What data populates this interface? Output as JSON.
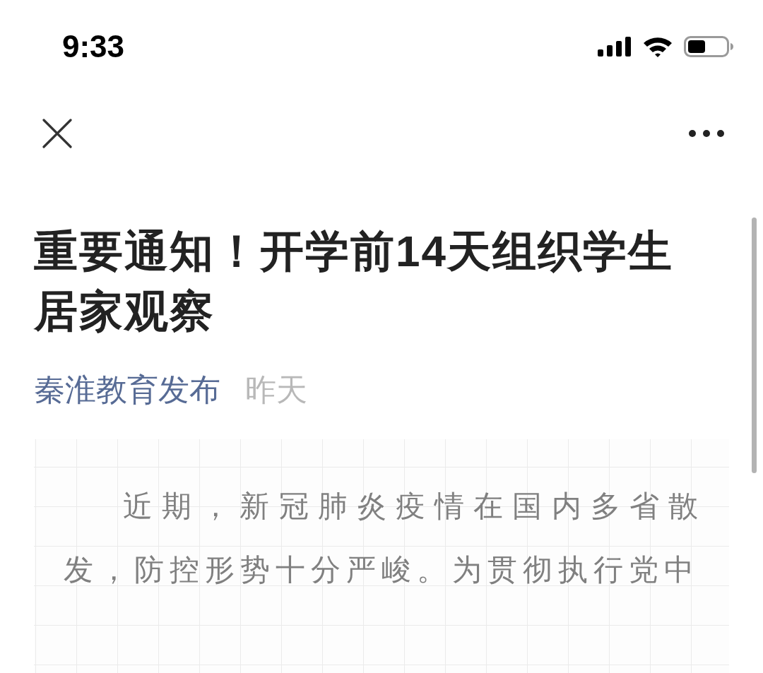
{
  "status_bar": {
    "time": "9:33"
  },
  "article": {
    "title": "重要通知！开学前14天组织学生居家观察",
    "author": "秦淮教育发布",
    "date": "昨天",
    "paragraphs": [
      "近期，新冠肺炎疫情在国内多省散发，防控形势十分严峻。为贯彻执行党中"
    ]
  }
}
